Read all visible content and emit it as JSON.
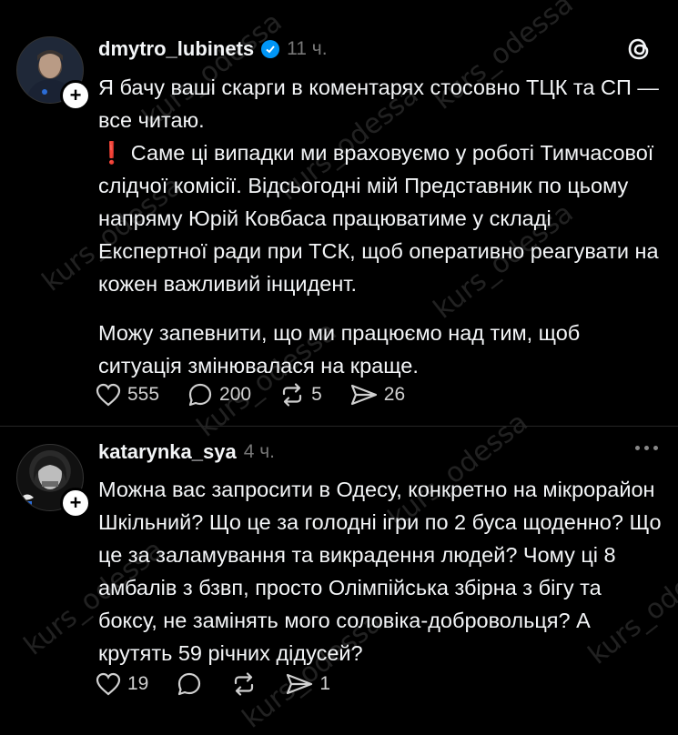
{
  "post1": {
    "username": "dmytro_lubinets",
    "time": "11 ч.",
    "paragraphs": [
      "Я бачу ваші скарги в коментарях стосовно ТЦК та СП — все читаю.",
      "❗ Саме ці випадки ми враховуємо у роботі Тимчасової слідчої комісії. Відсьогодні мій Представник по цьому напряму Юрій Ковбаса працюватиме у складі Експертної ради при ТСК, щоб оперативно реагувати на кожен важливий інцидент.",
      "Можу запевнити, що ми працюємо над тим, щоб ситуація змінювалася на краще."
    ],
    "likes": "555",
    "comments": "200",
    "reposts": "5",
    "shares": "26"
  },
  "post2": {
    "username": "katarynka_sya",
    "time": "4 ч.",
    "text": "Можна вас запросити в Одесу, конкретно на мікрорайон Шкільний? Що це за голодні ігри по 2 буса щоденно? Що це за заламування та викрадення людей? Чому ці 8 амбалів з бзвп, просто Олімпійська збірна з бігу та боксу, не замінять мого соловіка-добровольця? А крутять 59 річних дідусей?",
    "likes": "19",
    "shares": "1"
  },
  "watermark": "kurs_odessa",
  "icons": {
    "verified": "verified-badge-icon",
    "threads": "threads-logo-icon",
    "heart": "heart-icon",
    "comment": "comment-icon",
    "repost": "repost-icon",
    "share": "share-icon",
    "more": "more-icon",
    "follow": "plus-icon"
  },
  "colors": {
    "background": "#000000",
    "text": "#f3f5f7",
    "muted": "#777777",
    "verified": "#0095f6"
  }
}
